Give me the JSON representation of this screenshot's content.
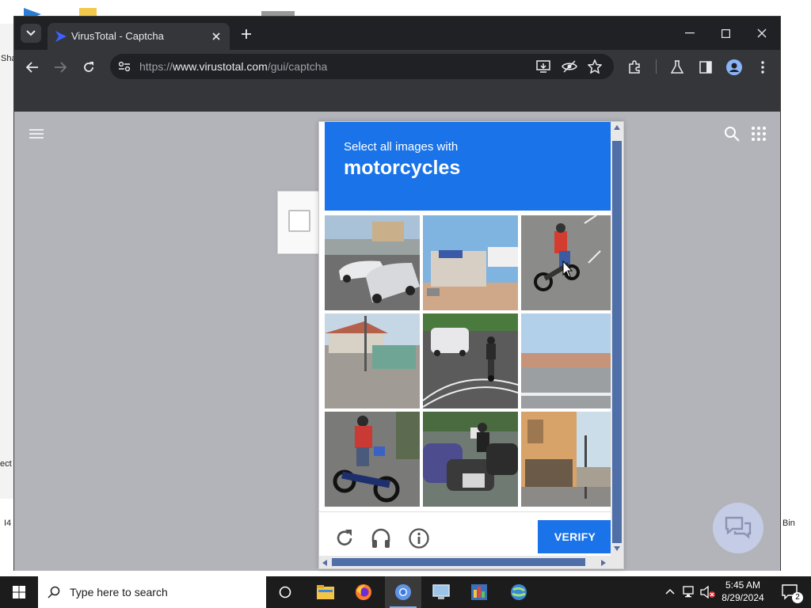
{
  "desktop": {
    "left_labels": [
      "Sha",
      "ect",
      "I4"
    ],
    "right_label": "Bin"
  },
  "browser": {
    "tab_title": "VirusTotal - Captcha",
    "url_prefix": "https://",
    "url_host": "www.virustotal.com",
    "url_path": "/gui/captcha"
  },
  "captcha": {
    "instruction": "Select all images with",
    "target": "motorcycles",
    "verify_label": "VERIFY",
    "tiles": [
      {
        "name": "tile-cars-street"
      },
      {
        "name": "tile-storefront"
      },
      {
        "name": "tile-motorcycle-red-rider"
      },
      {
        "name": "tile-houses"
      },
      {
        "name": "tile-car-motorcycle-road"
      },
      {
        "name": "tile-wall-road"
      },
      {
        "name": "tile-motorcycle-rider-red-jacket"
      },
      {
        "name": "tile-parked-motorcycles"
      },
      {
        "name": "tile-shop-building"
      }
    ]
  },
  "taskbar": {
    "search_placeholder": "Type here to search",
    "time": "5:45 AM",
    "date": "8/29/2024",
    "notifications_count": "2"
  }
}
